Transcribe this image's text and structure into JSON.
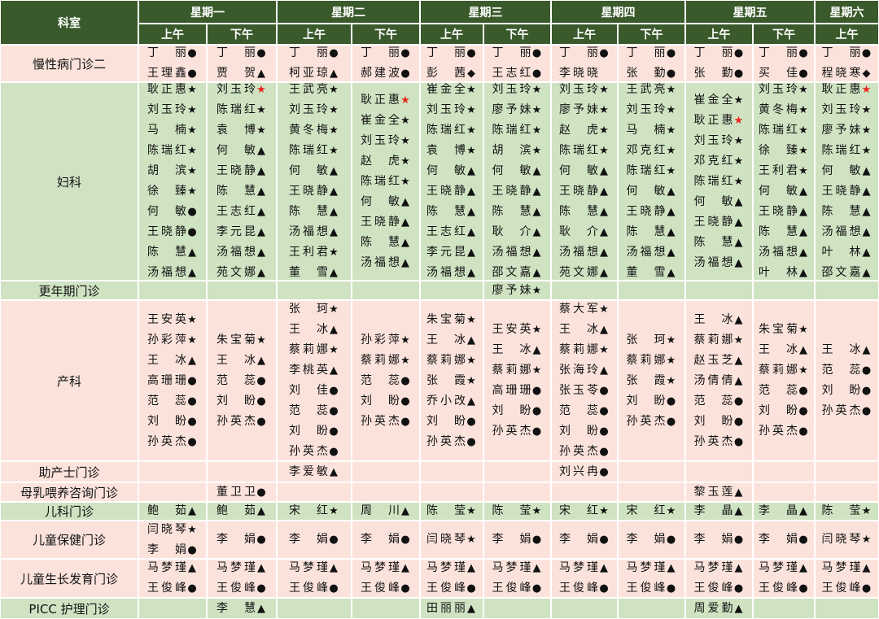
{
  "header": {
    "dept_label": "科室",
    "days": [
      "星期一",
      "星期二",
      "星期三",
      "星期四",
      "星期五",
      "星期六"
    ],
    "am": "上午",
    "pm": "下午"
  },
  "rows": [
    {
      "dept": "慢性病门诊二",
      "bg": "pink",
      "cells": [
        [
          "丁丽●",
          "王理鑫●"
        ],
        [
          "丁丽●",
          "贾贺▲"
        ],
        [
          "丁丽●",
          "柯亚琼▲"
        ],
        [
          "丁丽●",
          "郝建波●"
        ],
        [
          "丁丽●",
          "彭茜◆"
        ],
        [
          "丁丽●",
          "王志红●"
        ],
        [
          "丁丽●",
          "李晓晓"
        ],
        [
          "丁丽●",
          "张勤●"
        ],
        [
          "丁丽●",
          "张勤●"
        ],
        [
          "丁丽●",
          "买佳●"
        ],
        [
          "丁丽●",
          "程晓寒◆"
        ]
      ]
    },
    {
      "dept": "妇科",
      "bg": "green",
      "cells": [
        [
          "耿正惠★",
          "刘玉玲★",
          "马楠★",
          "陈瑞红★",
          "胡滨★",
          "徐臻★",
          "何敏●",
          "王晓静●",
          "陈慧▲",
          "汤福想▲"
        ],
        [
          "刘玉玲★",
          "陈瑞红★",
          "袁博★",
          "何敏▲",
          "王晓静▲",
          "陈慧▲",
          "王志红▲",
          "李元昆▲",
          "汤福想▲",
          "苑文娜▲"
        ],
        [
          "王武亮★",
          "刘玉玲★",
          "黄冬梅★",
          "陈瑞红★",
          "何敏▲",
          "王晓静▲",
          "陈慧▲",
          "汤福想▲",
          "王利君★",
          "董雪▲"
        ],
        [
          "耿正惠★",
          "崔金全★",
          "刘玉玲★",
          "赵虎★",
          "陈瑞红★",
          "何敏▲",
          "王晓静▲",
          "陈慧▲",
          "汤福想▲"
        ],
        [
          "崔金全★",
          "刘玉玲★",
          "陈瑞红★",
          "袁博★",
          "何敏▲",
          "王晓静▲",
          "陈慧▲",
          "王志红▲",
          "李元昆▲",
          "汤福想▲"
        ],
        [
          "刘玉玲★",
          "廖予妹★",
          "陈瑞红★",
          "胡滨★",
          "何敏▲",
          "王晓静▲",
          "陈慧▲",
          "耿介▲",
          "汤福想▲",
          "邵文嘉▲"
        ],
        [
          "刘玉玲★",
          "廖予妹★",
          "赵虎★",
          "陈瑞红★",
          "何敏▲",
          "王晓静▲",
          "陈慧▲",
          "耿介▲",
          "汤福想▲",
          "苑文娜▲"
        ],
        [
          "王武亮★",
          "刘玉玲★",
          "马楠★",
          "邓克红★",
          "陈瑞红★",
          "何敏▲",
          "王晓静▲",
          "陈慧▲",
          "汤福想▲",
          "董雪▲"
        ],
        [
          "崔金全★",
          "耿正惠★",
          "刘玉玲★",
          "邓克红★",
          "陈瑞红★",
          "何敏▲",
          "王晓静▲",
          "陈慧▲",
          "汤福想▲"
        ],
        [
          "刘玉玲★",
          "黄冬梅★",
          "陈瑞红★",
          "徐臻★",
          "王利君★",
          "何敏▲",
          "王晓静▲",
          "陈慧▲",
          "汤福想▲",
          "叶林▲"
        ],
        [
          "耿正惠★",
          "刘玉玲★",
          "廖予妹★",
          "陈瑞红★",
          "何敏▲",
          "王晓静▲",
          "陈慧▲",
          "汤福想▲",
          "叶林▲",
          "邵文嘉▲"
        ]
      ]
    },
    {
      "dept": "更年期门诊",
      "bg": "green",
      "cells": [
        [],
        [],
        [],
        [],
        [],
        [
          "廖予妹★"
        ],
        [],
        [],
        [],
        [],
        []
      ]
    },
    {
      "dept": "产科",
      "bg": "pink",
      "cells": [
        [
          "王安英★",
          "孙彩萍★",
          "王冰▲",
          "高珊珊●",
          "范蕊●",
          "刘盼●",
          "孙英杰●"
        ],
        [
          "朱宝菊★",
          "王冰▲",
          "范蕊●",
          "刘盼●",
          "孙英杰●"
        ],
        [
          "张珂★",
          "王冰▲",
          "蔡莉娜★",
          "李桃英▲",
          "刘佳●",
          "范蕊●",
          "刘盼●",
          "孙英杰●"
        ],
        [
          "孙彩萍★",
          "蔡莉娜★",
          "范蕊●",
          "刘盼●",
          "孙英杰●"
        ],
        [
          "朱宝菊★",
          "王冰▲",
          "蔡莉娜★",
          "张霞★",
          "乔小改▲",
          "刘盼●",
          "孙英杰●"
        ],
        [
          "王安英★",
          "王冰▲",
          "蔡莉娜★",
          "高珊珊●",
          "刘盼●",
          "孙英杰●"
        ],
        [
          "蔡大军★",
          "王冰▲",
          "蔡莉娜★",
          "张海玲▲",
          "张玉苓●",
          "范蕊●",
          "刘盼●",
          "孙英杰●"
        ],
        [
          "张珂★",
          "蔡莉娜★",
          "张霞★",
          "刘盼●",
          "孙英杰●"
        ],
        [
          "王冰▲",
          "蔡莉娜★",
          "赵玉芝▲",
          "汤倩倩▲",
          "范蕊●",
          "刘盼●",
          "孙英杰●"
        ],
        [
          "朱宝菊★",
          "王冰▲",
          "蔡莉娜★",
          "范蕊●",
          "刘盼●",
          "孙英杰●"
        ],
        [
          "王冰▲",
          "范蕊●",
          "刘盼●",
          "孙英杰●"
        ]
      ]
    },
    {
      "dept": "助产士门诊",
      "bg": "pink",
      "cells": [
        [],
        [],
        [
          "李爱敏▲"
        ],
        [],
        [],
        [],
        [
          "刘兴冉●"
        ],
        [],
        [],
        [],
        []
      ]
    },
    {
      "dept": "母乳喂养咨询门诊",
      "bg": "pink",
      "cells": [
        [],
        [
          "董卫卫●"
        ],
        [],
        [],
        [],
        [],
        [],
        [],
        [
          "黎玉莲▲"
        ],
        [],
        []
      ]
    },
    {
      "dept": "儿科门诊",
      "bg": "green",
      "cells": [
        [
          "鲍茹▲"
        ],
        [
          "鲍茹▲"
        ],
        [
          "宋红★"
        ],
        [
          "周川▲"
        ],
        [
          "陈莹★"
        ],
        [
          "陈莹★"
        ],
        [
          "宋红★"
        ],
        [
          "宋红★"
        ],
        [
          "李晶▲"
        ],
        [
          "李晶▲"
        ],
        [
          "陈莹★"
        ]
      ]
    },
    {
      "dept": "儿童保健门诊",
      "bg": "pink",
      "cells": [
        [
          "闫晓琴★",
          "李娟●"
        ],
        [
          "李娟●"
        ],
        [
          "李娟●"
        ],
        [
          "李娟●"
        ],
        [
          "闫晓琴★"
        ],
        [
          "李娟●"
        ],
        [
          "李娟●"
        ],
        [
          "李娟●"
        ],
        [
          "李娟●"
        ],
        [
          "李娟●"
        ],
        [
          "闫晓琴★"
        ]
      ]
    },
    {
      "dept": "儿童生长发育门诊",
      "bg": "pink",
      "cells": [
        [
          "马梦瑾▲",
          "王俊峰●"
        ],
        [
          "马梦瑾▲",
          "王俊峰●"
        ],
        [
          "马梦瑾▲",
          "王俊峰●"
        ],
        [
          "马梦瑾▲",
          "王俊峰●"
        ],
        [
          "马梦瑾▲",
          "王俊峰●"
        ],
        [
          "马梦瑾▲",
          "王俊峰●"
        ],
        [
          "马梦瑾▲",
          "王俊峰●"
        ],
        [
          "马梦瑾▲",
          "王俊峰●"
        ],
        [
          "马梦瑾▲",
          "王俊峰●"
        ],
        [
          "马梦瑾▲",
          "王俊峰●"
        ],
        [
          "马梦瑾▲",
          "王俊峰●"
        ]
      ]
    },
    {
      "dept": "PICC 护理门诊",
      "bg": "green",
      "cells": [
        [],
        [
          "李慧▲"
        ],
        [],
        [],
        [
          "田丽丽▲"
        ],
        [],
        [],
        [],
        [
          "周爱勤▲"
        ],
        [],
        []
      ]
    }
  ],
  "colors": {
    "header_bg": "#3a5a2c",
    "pink": "#fbe3dc",
    "green": "#cfe3c2",
    "star_red": "#e8241c"
  }
}
